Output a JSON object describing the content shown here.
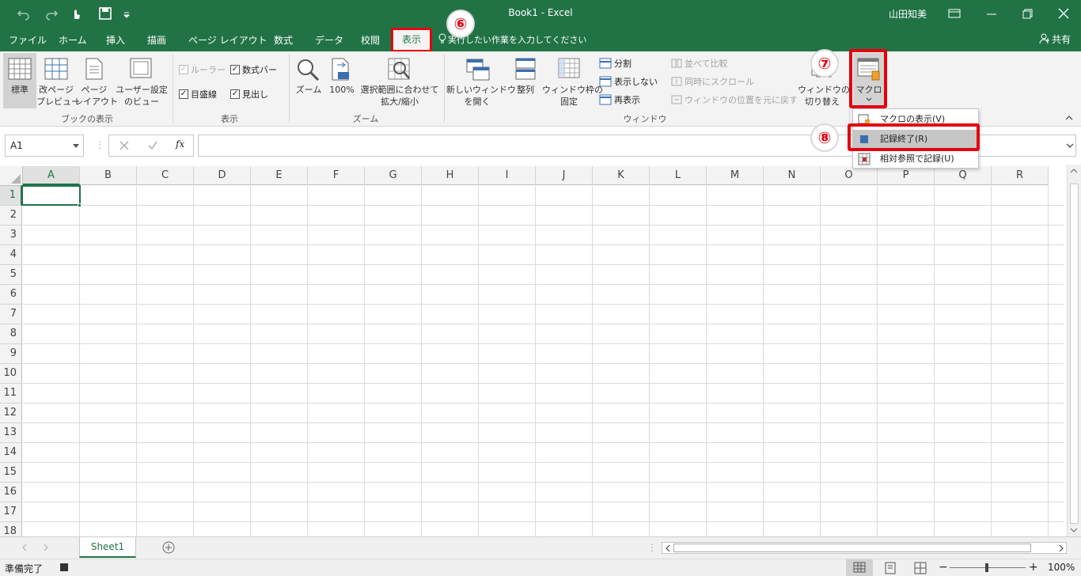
{
  "window": {
    "title": "Book1  -  Excel",
    "user": "山田知美",
    "share_label": "共有"
  },
  "tabs": [
    "ファイル",
    "ホーム",
    "挿入",
    "描画",
    "ページ レイアウト",
    "数式",
    "データ",
    "校閲"
  ],
  "active_tab": "表示",
  "tell_me": "実行したい作業を入力してください",
  "ribbon": {
    "workbook_views": {
      "group_label": "ブックの表示",
      "normal": "標準",
      "page_break_1": "改ページ",
      "page_break_2": "プレビュー",
      "page_layout_1": "ページ",
      "page_layout_2": "レイアウト",
      "custom_1": "ユーザー設定",
      "custom_2": "のビュー"
    },
    "show": {
      "group_label": "表示",
      "ruler": "ルーラー",
      "formula_bar": "数式バー",
      "gridlines": "目盛線",
      "headings": "見出し"
    },
    "zoom": {
      "group_label": "ズーム",
      "zoom": "ズーム",
      "zoom100": "100%",
      "zoom_sel_1": "選択範囲に合わせて",
      "zoom_sel_2": "拡大/縮小"
    },
    "window": {
      "group_label": "ウィンドウ",
      "new_window_1": "新しいウィンドウ",
      "new_window_2": "を開く",
      "arrange": "整列",
      "freeze_1": "ウィンドウ枠の",
      "freeze_2": "固定",
      "split": "分割",
      "hide": "表示しない",
      "unhide": "再表示",
      "side_by_side": "並べて比較",
      "sync_scroll": "同時にスクロール",
      "reset_pos": "ウィンドウの位置を元に戻す",
      "switch_1": "ウィンドウの",
      "switch_2": "切り替え"
    },
    "macros": {
      "label": "マクロ"
    }
  },
  "macro_menu": [
    "マクロの表示(V)",
    "記録終了(R)",
    "相対参照で記録(U)"
  ],
  "formula_bar": {
    "name_box": "A1",
    "fx": "fx",
    "value": ""
  },
  "columns": [
    "A",
    "B",
    "C",
    "D",
    "E",
    "F",
    "G",
    "H",
    "I",
    "J",
    "K",
    "L",
    "M",
    "N",
    "O",
    "P",
    "Q",
    "R"
  ],
  "rows": [
    "1",
    "2",
    "3",
    "4",
    "5",
    "6",
    "7",
    "8",
    "9",
    "10",
    "11",
    "12",
    "13",
    "14",
    "15",
    "16",
    "17",
    "18"
  ],
  "sheet_tab": "Sheet1",
  "status": {
    "ready": "準備完了",
    "zoom": "100%"
  },
  "callouts": {
    "c6": "⑥",
    "c7": "⑦",
    "c8": "⑧"
  },
  "colors": {
    "brand": "#217346",
    "highlight": "#e4000f"
  }
}
